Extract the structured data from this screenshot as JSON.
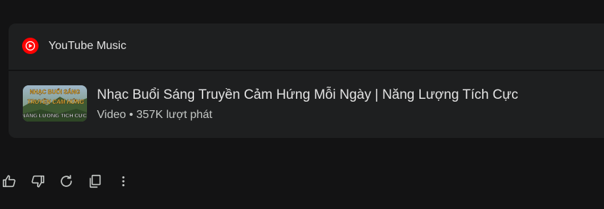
{
  "source": {
    "name": "YouTube Music",
    "icon": "youtube-music-icon",
    "brand_color": "#ff0000"
  },
  "result": {
    "title": "Nhạc Buổi Sáng Truyền Cảm Hứng Mỗi Ngày | Năng Lượng Tích Cực",
    "meta": "Video • 357K lượt phát",
    "thumbnail": {
      "line1": "NHẠC BUỔI SÁNG",
      "line2": "TRUYỀN CẢM HỨNG",
      "line3": "NĂNG LƯỢNG TÍCH CỰC"
    }
  },
  "actions": [
    {
      "name": "thumbs-up-icon"
    },
    {
      "name": "thumbs-down-icon"
    },
    {
      "name": "regenerate-icon"
    },
    {
      "name": "copy-icon"
    },
    {
      "name": "more-vert-icon"
    }
  ],
  "colors": {
    "page_bg": "#131314",
    "card_bg": "#1e1f20",
    "text_primary": "#e3e3e3",
    "text_secondary": "#c4c7c5",
    "icon": "#c4c7c5"
  }
}
